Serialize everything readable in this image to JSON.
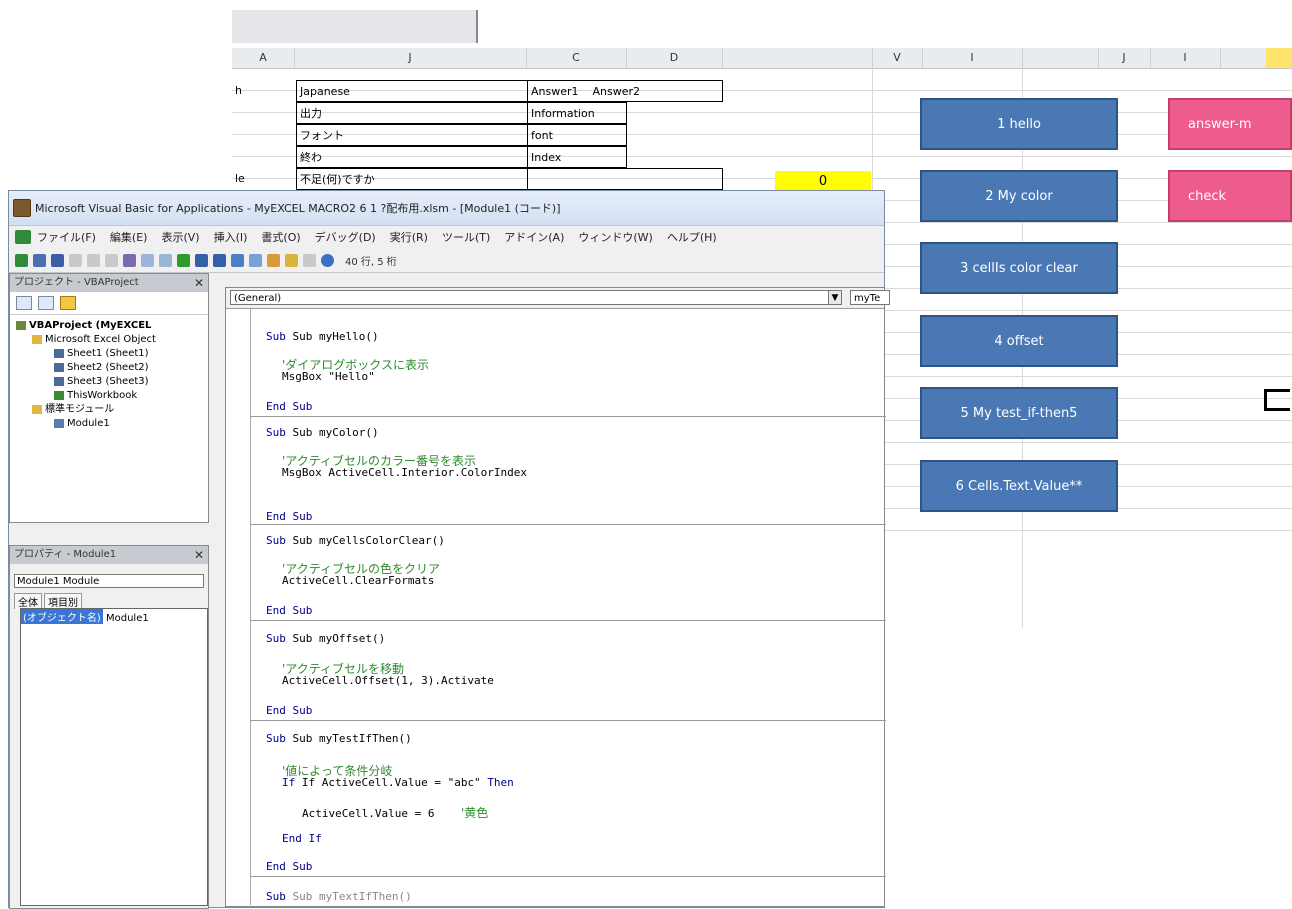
{
  "excel": {
    "columns": [
      "A",
      "J",
      "C",
      "D",
      "",
      "V",
      "I",
      "",
      "J",
      "I",
      ""
    ],
    "table_header": {
      "a": "h",
      "b": "Japanese",
      "c": "Answer1",
      "d": "Answer2"
    },
    "table_rows": [
      {
        "a": "",
        "b": "出力",
        "c": "Information"
      },
      {
        "a": "",
        "b": "フォント",
        "c": "font"
      },
      {
        "a": "",
        "b": "終わ",
        "c": "Index"
      },
      {
        "a": "le",
        "b": "不足(何)ですか",
        "c": ""
      }
    ],
    "yellow_value": "0",
    "buttons": [
      {
        "label": "1 hello",
        "color": "blue"
      },
      {
        "label": "2 My color",
        "color": "blue"
      },
      {
        "label": "3 cellIs color clear",
        "color": "blue"
      },
      {
        "label": "4 offset",
        "color": "blue"
      },
      {
        "label": "5 My test_if-then5",
        "color": "blue"
      },
      {
        "label": "6 Cells.Text.Value**",
        "color": "blue"
      },
      {
        "label": "answer-m",
        "color": "pink"
      },
      {
        "label": "check",
        "color": "pink"
      }
    ]
  },
  "vbe": {
    "title": "Microsoft Visual Basic for Applications - MyEXCEL  MACRO2 6 1 ?配布用.xlsm - [Module1 (コード)]",
    "menu": [
      "ファイル(F)",
      "編集(E)",
      "表示(V)",
      "挿入(I)",
      "書式(O)",
      "デバッグ(D)",
      "実行(R)",
      "ツール(T)",
      "アドイン(A)",
      "ウィンドウ(W)",
      "ヘルプ(H)"
    ],
    "toolbar_position": "40 行, 5 桁",
    "project_pane_title": "プロジェクト - VBAProject",
    "tree": [
      "VBAProject (MyEXCEL",
      "Microsoft Excel Object",
      "Sheet1 (Sheet1)",
      "Sheet2 (Sheet2)",
      "Sheet3 (Sheet3)",
      "ThisWorkbook",
      "標準モジュール",
      "Module1"
    ],
    "properties_title": "プロパティ - Module1",
    "properties_select": "Module1 Module",
    "properties_tabs": [
      "全体",
      "項目別"
    ],
    "properties_name_label": "(オブジェクト名)",
    "properties_name_value": "Module1",
    "code_object_combo": "(General)",
    "code_proc_combo": "myTe",
    "code": {
      "l1": "Sub myHello()",
      "c1": "'ダイアログボックスに表示",
      "l2": "MsgBox \"Hello\"",
      "e1": "End Sub",
      "l3": "Sub myColor()",
      "c2": "'アクティブセルのカラー番号を表示",
      "l4": "MsgBox ActiveCell.Interior.ColorIndex",
      "e2": "End Sub",
      "l5": "Sub myCellsColorClear()",
      "c3": "'アクティブセルの色をクリア",
      "l6": "ActiveCell.ClearFormats",
      "e3": "End Sub",
      "l7": "Sub myOffset()",
      "c4": "'アクティブセルを移動",
      "l8": "ActiveCell.Offset(1, 3).Activate",
      "e4": "End Sub",
      "l9": "Sub myTestIfThen()",
      "c5": "'値によって条件分岐",
      "l10a": "If ActiveCell.Value = \"abc\"",
      "l10b": "Then",
      "l11": "ActiveCell.Value = 6",
      "c6": "'黄色",
      "l12": "End If",
      "e5": "End Sub",
      "l13": "Sub myTextIfThen()"
    }
  }
}
